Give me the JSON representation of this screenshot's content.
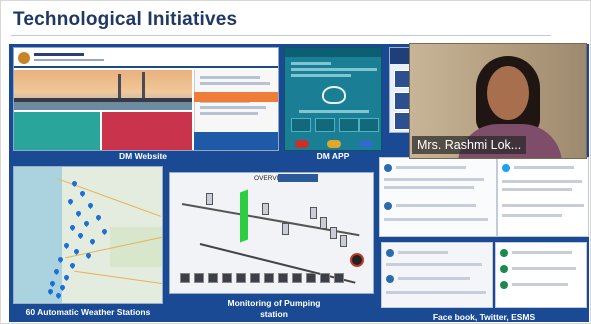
{
  "slide": {
    "title": "Technological Initiatives"
  },
  "panels": {
    "dm_website": "DM Website",
    "dm_app": "DM APP",
    "weather_stations": "60 Automatic Weather Stations",
    "pumping_line1": "Monitoring of Pumping",
    "pumping_line2": "station",
    "social_media": "Face book, Twitter, ESMS"
  },
  "pumping_screen": {
    "heading": "OVERVIEW"
  },
  "video_call": {
    "participant_name": "Mrs. Rashmi Lok..."
  },
  "colors": {
    "title": "#1f3864",
    "panel_background": "#1a4a93",
    "caption_text": "#ffffff",
    "map_pin": "#1c6fd6"
  },
  "icons": {
    "weather_station_marker": "map-pin-icon",
    "app_logo": "app-logo-icon"
  }
}
